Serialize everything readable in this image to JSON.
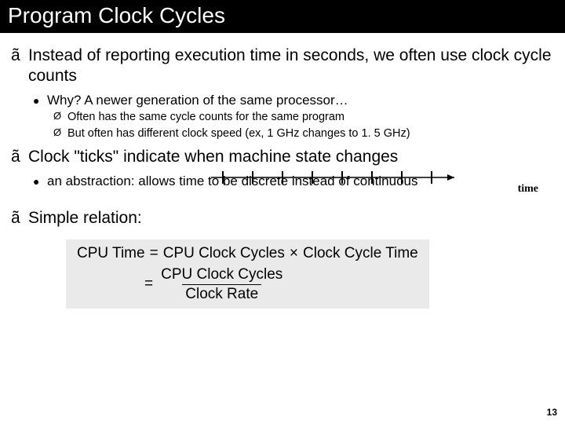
{
  "title": "Program Clock Cycles",
  "bullets": {
    "b1": "Instead of reporting execution time in seconds, we often use clock cycle counts",
    "b1a": "Why?  A newer generation of the same processor…",
    "b1a1": "Often has the same cycle counts for the same program",
    "b1a2": "But often has different clock speed (ex, 1 GHz changes to 1. 5 GHz)",
    "b2": "Clock \"ticks\" indicate when machine state changes",
    "b2a": "an abstraction:  allows time to be discrete instead of continuous",
    "b3": "Simple relation:"
  },
  "timeline_label": "time",
  "formula": {
    "lhs": "CPU Time",
    "eq": "=",
    "r1a": "CPU Clock Cycles",
    "times": "×",
    "r1b": "Clock Cycle Time",
    "r2num": "CPU Clock Cycles",
    "r2den": "Clock Rate"
  },
  "page_number": "13",
  "markers": {
    "a": "ã",
    "b": "●",
    "c": "Ø"
  }
}
